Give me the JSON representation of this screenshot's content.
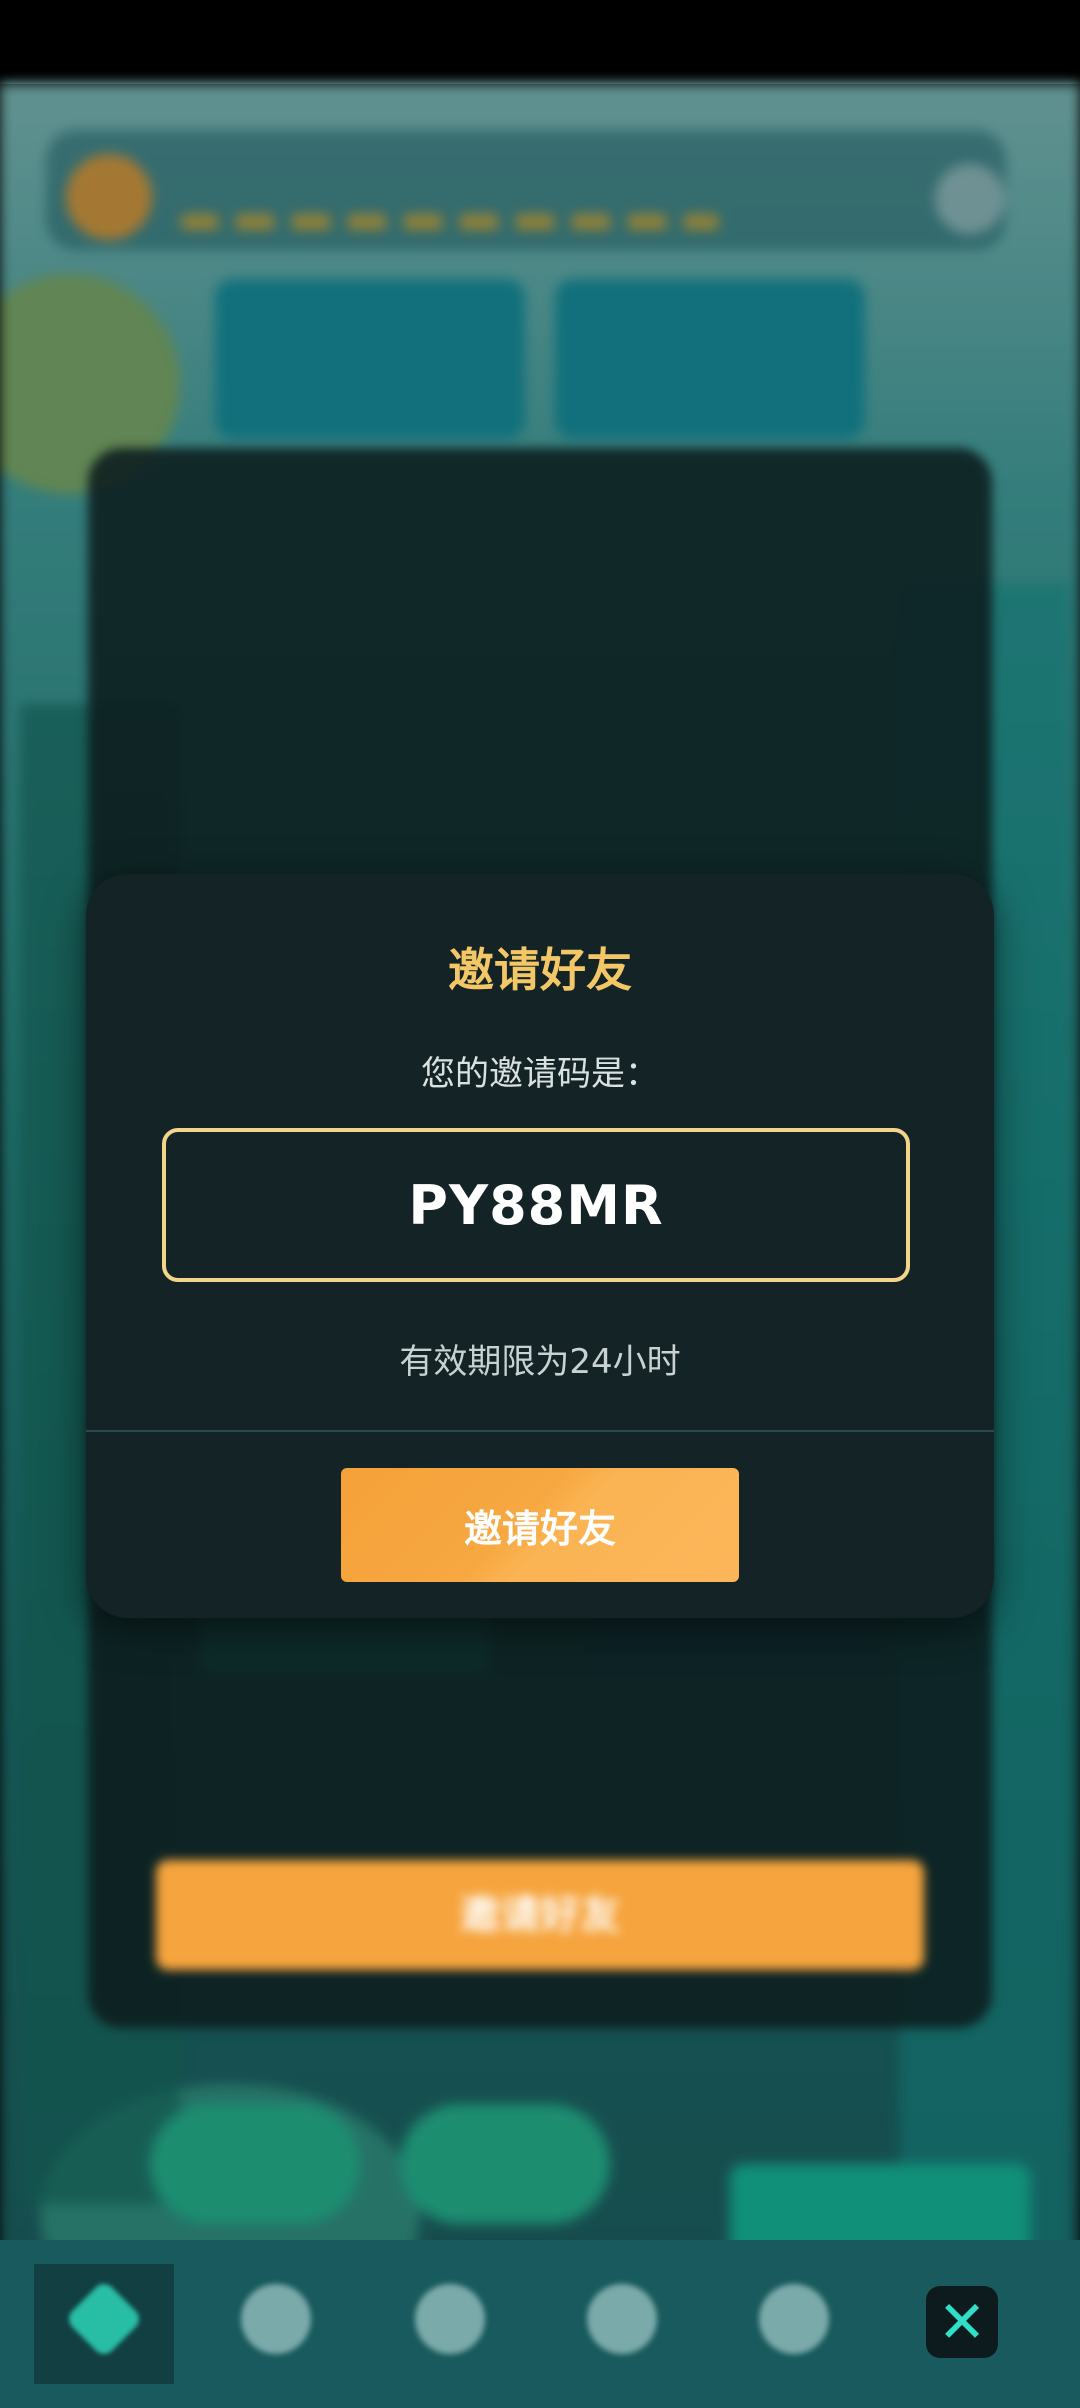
{
  "modal": {
    "title": "邀请好友",
    "subtitle": "您的邀请码是：",
    "invite_code": "PY88MR",
    "validity": "有效期限为24小时",
    "button_label": "邀请好友"
  },
  "background_dialog": {
    "button_label": "邀请好友"
  },
  "colors": {
    "accent_orange": "#f6a43d",
    "title_gold": "#f3c766",
    "code_border": "#f2d48a",
    "modal_bg": "#142326",
    "close_icon": "#2fe0c7"
  },
  "nav": {
    "icons": [
      "triangle-icon",
      "trophy-icon",
      "gear-icon",
      "diamond-icon",
      "heart-diamond-icon",
      "close-icon"
    ],
    "active_index": 0
  }
}
